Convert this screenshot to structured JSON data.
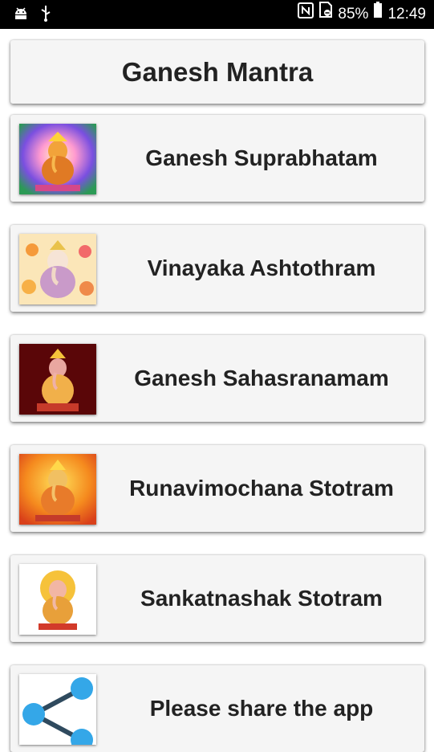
{
  "status_bar": {
    "left_icons": [
      "android-icon",
      "usb-icon"
    ],
    "right_icons": [
      "nfc-icon",
      "no-sim-icon",
      "battery-icon"
    ],
    "battery": "85%",
    "time": "12:49"
  },
  "header": {
    "title": "Ganesh Mantra"
  },
  "items": [
    {
      "label": "Ganesh Suprabhatam",
      "thumb": "ganesha-image"
    },
    {
      "label": "Vinayaka Ashtothram",
      "thumb": "ganesha-image"
    },
    {
      "label": "Ganesh Sahasranamam",
      "thumb": "ganesha-image"
    },
    {
      "label": "Runavimochana Stotram",
      "thumb": "ganesha-image"
    },
    {
      "label": "Sankatnashak Stotram",
      "thumb": "ganesha-image"
    },
    {
      "label": "Please share the app",
      "thumb": "share-icon"
    }
  ]
}
